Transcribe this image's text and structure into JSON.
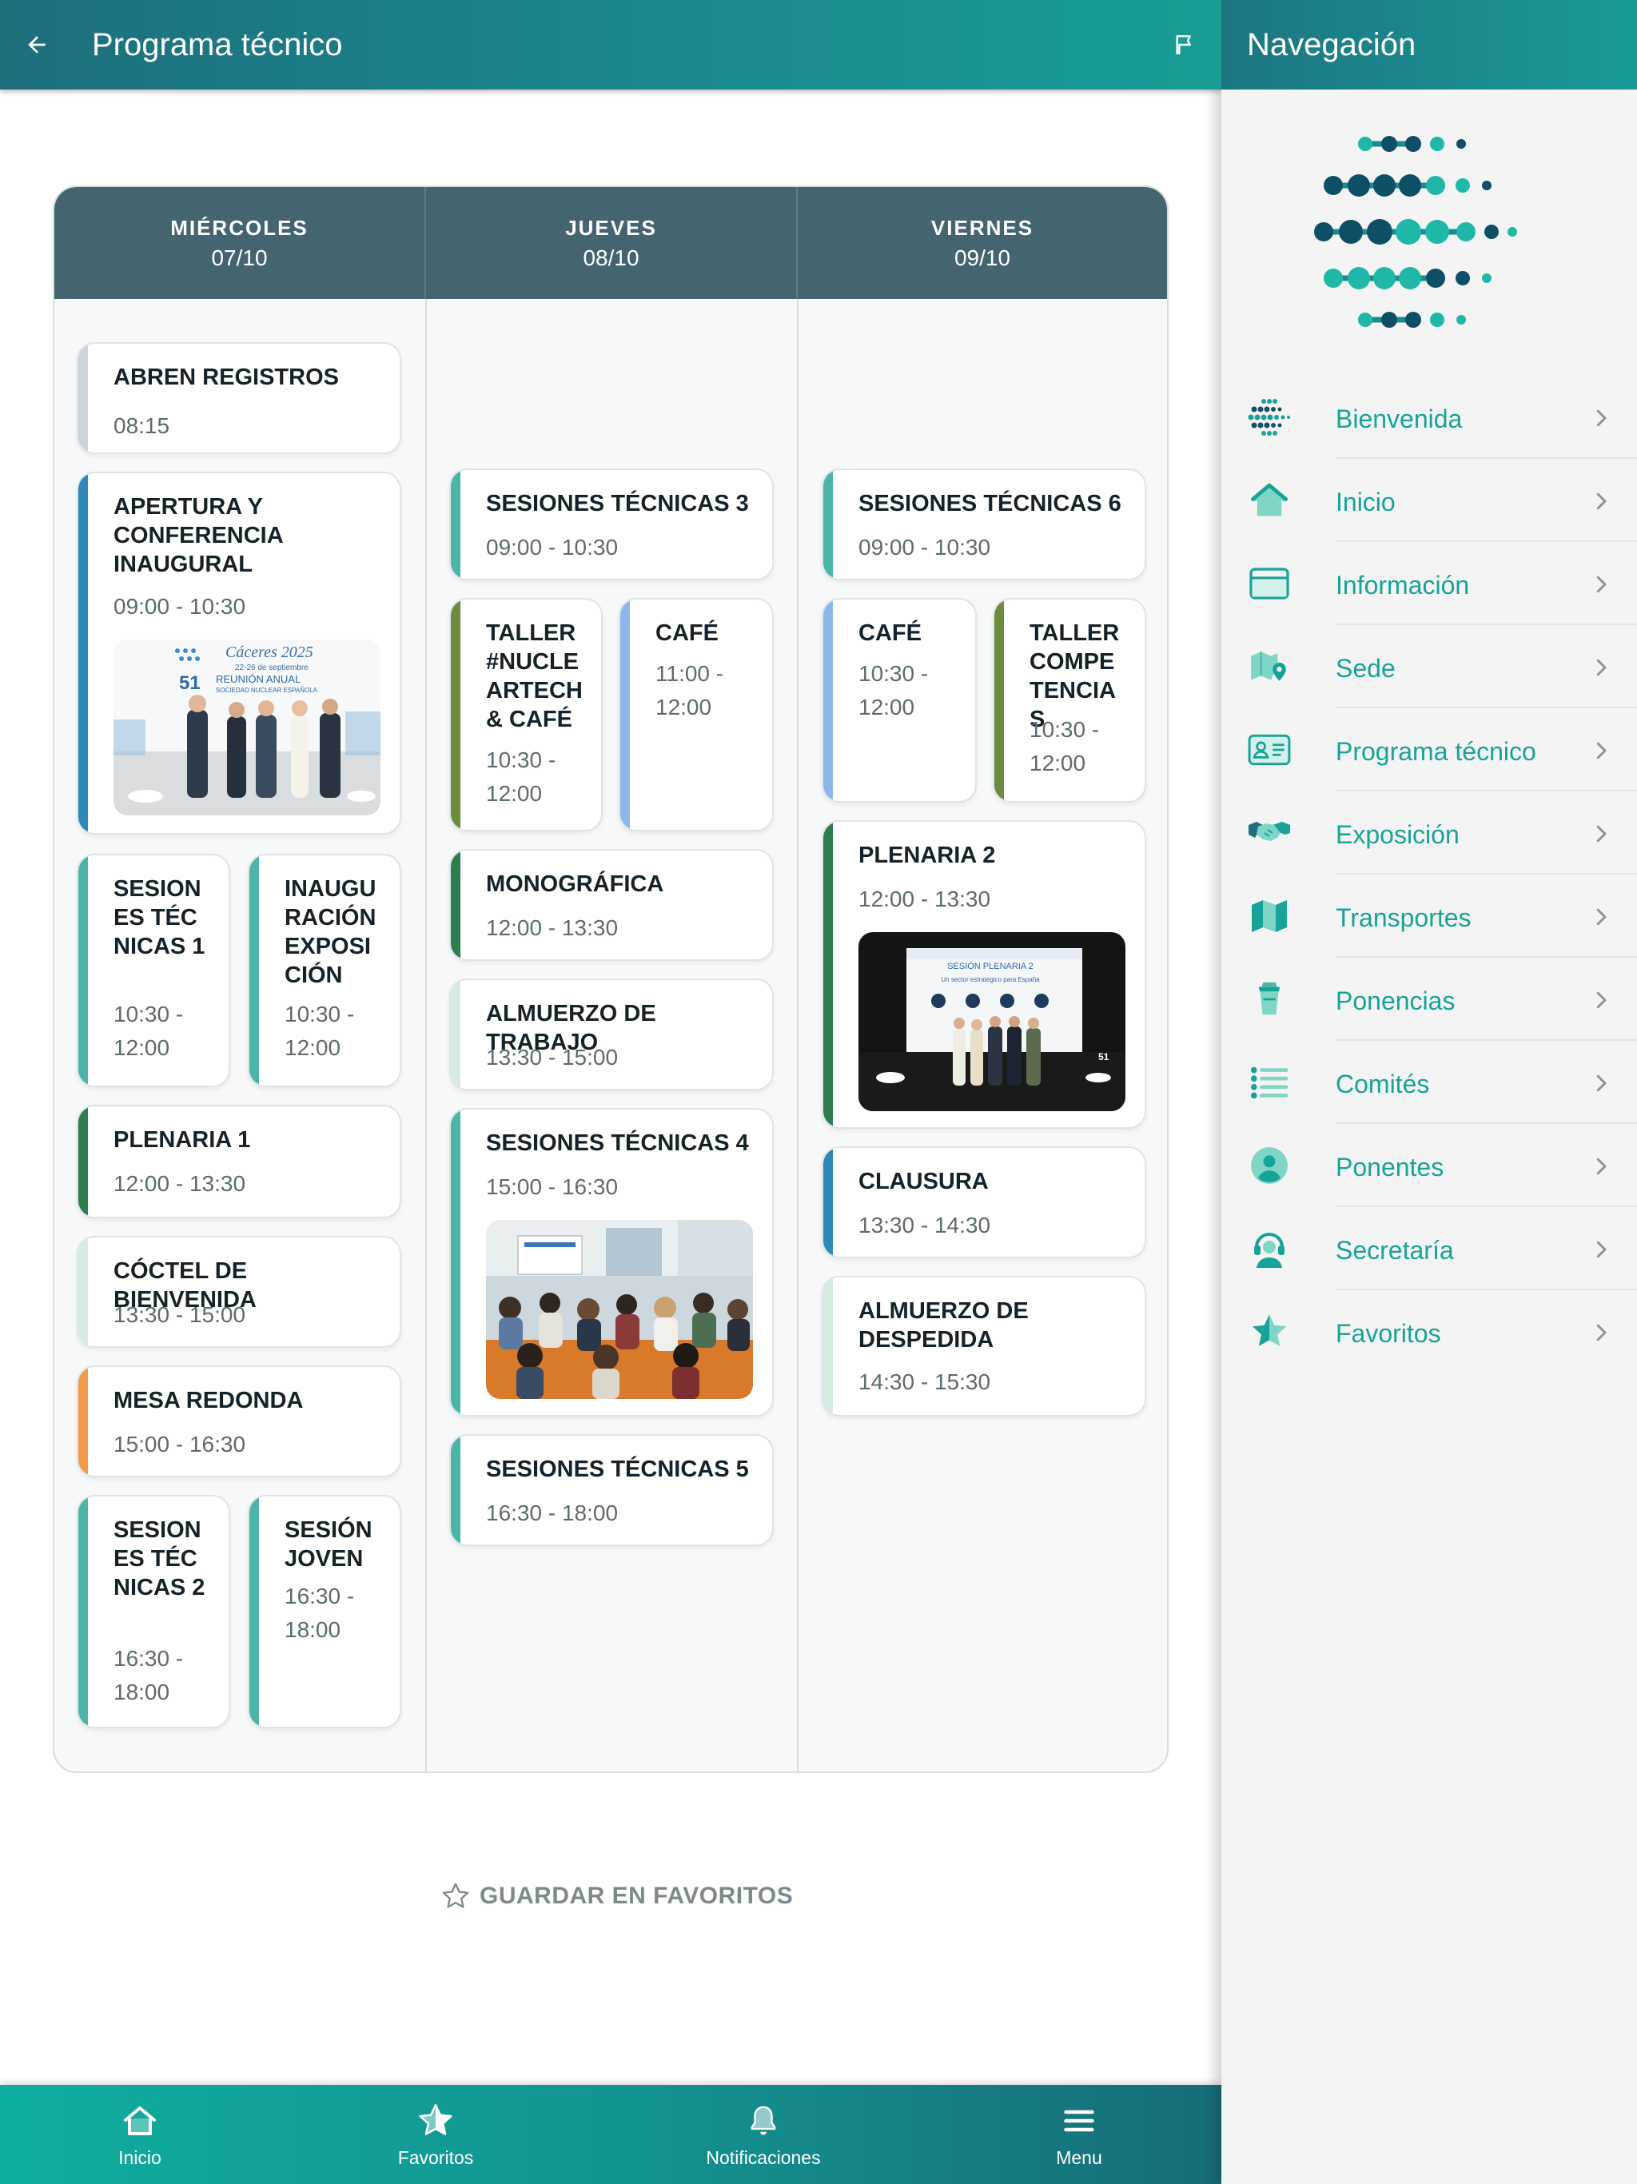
{
  "topbar": {
    "title": "Programa técnico"
  },
  "schedule": {
    "days": [
      {
        "name": "MIÉRCOLES",
        "date": "07/10"
      },
      {
        "name": "JUEVES",
        "date": "08/10"
      },
      {
        "name": "VIERNES",
        "date": "09/10"
      }
    ],
    "events": {
      "e1": {
        "title": "ABREN REGISTROS",
        "time": "08:15",
        "color": "#c9d4da"
      },
      "e2": {
        "title": "APERTURA Y CONFERENCIA INAUGURAL",
        "time": "09:00 - 10:30",
        "color": "#2e88b8"
      },
      "e3": {
        "title": "SESIONES TÉCNICAS 1",
        "time": "10:30 - 12:00",
        "color": "#4bb5a8"
      },
      "e4": {
        "title": "INAUGURACIÓN EXPOSICIÓN",
        "time": "10:30 - 12:00",
        "color": "#4bb5a8"
      },
      "e5": {
        "title": "PLENARIA 1",
        "time": "12:00 - 13:30",
        "color": "#2f7d4f"
      },
      "e6": {
        "title": "CÓCTEL DE BIENVENIDA",
        "time": "13:30 - 15:00",
        "color": "#d6ece0"
      },
      "e7": {
        "title": "MESA REDONDA",
        "time": "15:00 - 16:30",
        "color": "#f29a4a"
      },
      "e8": {
        "title": "SESIONES TÉCNICAS 2",
        "time": "16:30 - 18:00",
        "color": "#4bb5a8"
      },
      "e9": {
        "title": "SESIÓN JOVEN",
        "time": "16:30 - 18:00",
        "color": "#4bb5a8"
      },
      "e10": {
        "title": "SESIONES TÉCNICAS 3",
        "time": "09:00 - 10:30",
        "color": "#4bb5a8"
      },
      "e11": {
        "title": "TALLER #NUCLEARTECH & CAFÉ",
        "time": "10:30 - 12:00",
        "color": "#6c8b3e"
      },
      "e12": {
        "title": "CAFÉ",
        "time": "11:00 - 12:00",
        "color": "#8db7ea"
      },
      "e13": {
        "title": "MONOGRÁFICA",
        "time": "12:00 - 13:30",
        "color": "#2f7d4f"
      },
      "e14": {
        "title": "ALMUERZO DE TRABAJO",
        "time": "13:30 - 15:00",
        "color": "#d6ece0"
      },
      "e15": {
        "title": "SESIONES TÉCNICAS 4",
        "time": "15:00 - 16:30",
        "color": "#4bb5a8"
      },
      "e16": {
        "title": "SESIONES TÉCNICAS 5",
        "time": "16:30 - 18:00",
        "color": "#4bb5a8"
      },
      "e17": {
        "title": "SESIONES TÉCNICAS 6",
        "time": "09:00 - 10:30",
        "color": "#4bb5a8"
      },
      "e18": {
        "title": "CAFÉ",
        "time": "10:30 - 12:00",
        "color": "#8db7ea"
      },
      "e19": {
        "title": "TALLER COMPETENCIAS",
        "time": "10:30 - 12:00",
        "color": "#6c8b3e"
      },
      "e20": {
        "title": "PLENARIA 2",
        "time": "12:00 - 13:30",
        "color": "#2f7d4f"
      },
      "e21": {
        "title": "CLAUSURA",
        "time": "13:30 - 14:30",
        "color": "#2e88b8"
      },
      "e22": {
        "title": "ALMUERZO DE DESPEDIDA",
        "time": "14:30 - 15:30",
        "color": "#d6ece0"
      }
    },
    "photos": {
      "opening": {
        "line1": "Cáceres 2025",
        "line2": "22-26 de septiembre",
        "number": "51",
        "line3": "REUNIÓN ANUAL",
        "line4": "SOCIEDAD NUCLEAR ESPAÑOLA"
      },
      "plenary": {
        "line1": "SESIÓN PLENARIA 2",
        "line2": "Un sector estratégico para España",
        "number": "51"
      }
    }
  },
  "favorite": {
    "label": "GUARDAR EN FAVORITOS",
    "icon": "star-outline-icon"
  },
  "bottom_nav": [
    {
      "label": "Inicio",
      "icon": "home-icon"
    },
    {
      "label": "Favoritos",
      "icon": "star-icon"
    },
    {
      "label": "Notificaciones",
      "icon": "bell-icon"
    },
    {
      "label": "Menu",
      "icon": "menu-icon"
    }
  ],
  "drawer": {
    "title": "Navegación",
    "items": [
      {
        "label": "Bienvenida",
        "icon": "logo-dots-icon"
      },
      {
        "label": "Inicio",
        "icon": "home-icon"
      },
      {
        "label": "Información",
        "icon": "browser-window-icon"
      },
      {
        "label": "Sede",
        "icon": "map-pin-icon"
      },
      {
        "label": "Programa técnico",
        "icon": "id-card-icon"
      },
      {
        "label": "Exposición",
        "icon": "handshake-icon"
      },
      {
        "label": "Transportes",
        "icon": "map-icon"
      },
      {
        "label": "Ponencias",
        "icon": "cup-icon"
      },
      {
        "label": "Comités",
        "icon": "list-icon"
      },
      {
        "label": "Ponentes",
        "icon": "person-icon"
      },
      {
        "label": "Secretaría",
        "icon": "support-agent-icon"
      },
      {
        "label": "Favoritos",
        "icon": "star-icon"
      }
    ]
  },
  "colors": {
    "accent": "#17a398",
    "header": "#446570",
    "topbar": "#1a8b8f"
  }
}
